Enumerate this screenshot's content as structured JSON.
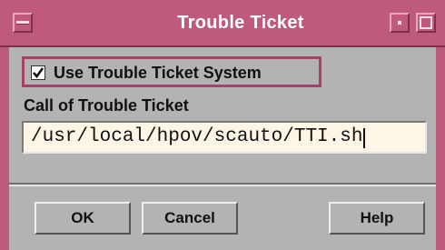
{
  "window": {
    "title": "Trouble Ticket"
  },
  "options": {
    "use_tts_label": "Use Trouble Ticket System",
    "use_tts_checked": true
  },
  "call_field": {
    "label": "Call of Trouble Ticket",
    "value": "/usr/local/hpov/scauto/TTI.sh"
  },
  "buttons": {
    "ok": "OK",
    "cancel": "Cancel",
    "help": "Help"
  },
  "icons": {
    "window_menu": "window-menu-icon",
    "minimize": "minimize-icon",
    "maximize": "maximize-icon",
    "checkmark": "checkmark-icon"
  },
  "colors": {
    "titlebar": "#c05a7a",
    "focus_frame": "#a8406a",
    "field_bg": "#fdf6e6",
    "dialog_bg": "#b3b3b3"
  }
}
